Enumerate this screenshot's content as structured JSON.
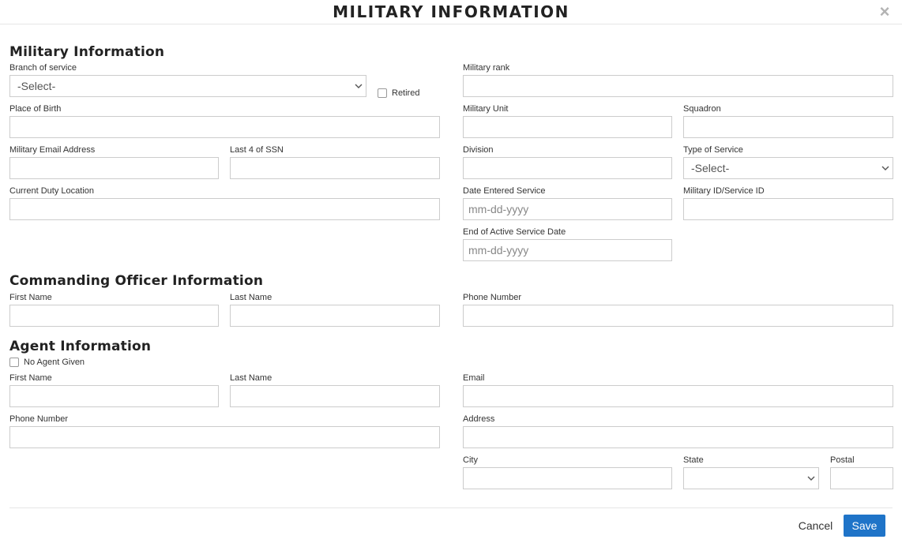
{
  "modal": {
    "title": "MILITARY INFORMATION",
    "close": "×"
  },
  "military": {
    "heading": "Military Information",
    "branch_label": "Branch of service",
    "branch_value": "-Select-",
    "retired_label": "Retired",
    "rank_label": "Military rank",
    "birthplace_label": "Place of Birth",
    "unit_label": "Military Unit",
    "squadron_label": "Squadron",
    "email_label": "Military Email Address",
    "ssn_label": "Last 4 of SSN",
    "division_label": "Division",
    "service_type_label": "Type of Service",
    "service_type_value": "-Select-",
    "duty_location_label": "Current Duty Location",
    "date_entered_label": "Date Entered Service",
    "date_entered_placeholder": "mm-dd-yyyy",
    "service_id_label": "Military ID/Service ID",
    "end_active_label": "End of Active Service Date",
    "end_active_placeholder": "mm-dd-yyyy"
  },
  "commanding": {
    "heading": "Commanding Officer Information",
    "first_name_label": "First Name",
    "last_name_label": "Last Name",
    "phone_label": "Phone Number"
  },
  "agent": {
    "heading": "Agent Information",
    "no_agent_label": "No Agent Given",
    "first_name_label": "First Name",
    "last_name_label": "Last Name",
    "email_label": "Email",
    "phone_label": "Phone Number",
    "address_label": "Address",
    "city_label": "City",
    "state_label": "State",
    "state_value": "",
    "postal_label": "Postal"
  },
  "footer": {
    "cancel_label": "Cancel",
    "save_label": "Save"
  },
  "colors": {
    "primary": "#1f74c8",
    "border": "#cccccc",
    "divider": "#e6e6e6"
  }
}
